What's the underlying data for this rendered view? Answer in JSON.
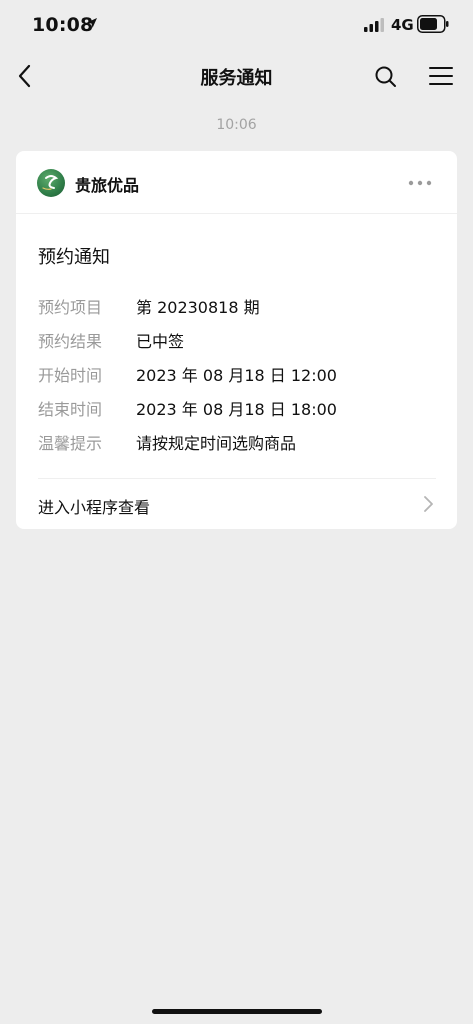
{
  "status_bar": {
    "time": "10:08",
    "network": "4G"
  },
  "nav": {
    "title": "服务通知"
  },
  "timestamp": "10:06",
  "card": {
    "app_name": "贵旅优品",
    "title": "预约通知",
    "fields": [
      {
        "label": "预约项目",
        "value": "第 20230818 期"
      },
      {
        "label": "预约结果",
        "value": "已中签"
      },
      {
        "label": "开始时间",
        "value": "2023 年 08 月18 日 12:00"
      },
      {
        "label": "结束时间",
        "value": "2023 年 08 月18 日 18:00"
      },
      {
        "label": "温馨提示",
        "value": "请按规定时间选购商品"
      }
    ],
    "footer_link": "进入小程序查看"
  },
  "colors": {
    "background": "#ededed",
    "card": "#ffffff",
    "label_gray": "#9a9a9a",
    "logo_green": "#2f7d48"
  }
}
